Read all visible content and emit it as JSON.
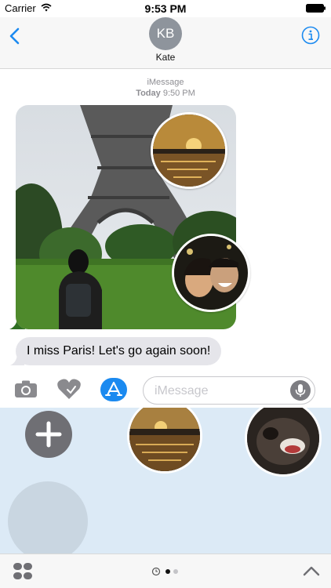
{
  "status_bar": {
    "carrier": "Carrier",
    "time": "9:53 PM"
  },
  "header": {
    "avatar_initials": "KB",
    "contact_name": "Kate"
  },
  "conversation": {
    "service": "iMessage",
    "day": "Today",
    "time": "9:50 PM",
    "message_text": "I miss Paris! Let's go again soon!"
  },
  "input": {
    "placeholder": "iMessage"
  },
  "icons": {
    "back": "chevron-left-icon",
    "info": "info-icon",
    "camera": "camera-icon",
    "digital_touch": "heart-touch-icon",
    "app_store": "app-store-icon",
    "mic": "microphone-icon",
    "add": "plus-icon",
    "app_drawer": "grid-icon",
    "recents": "clock-icon",
    "collapse": "chevron-up-icon"
  },
  "page_indicator": {
    "pages": 3,
    "current": 2
  },
  "colors": {
    "accent": "#1b8af0",
    "bubble_gray": "#e5e5ea",
    "drawer_bg": "#dceaf6"
  }
}
